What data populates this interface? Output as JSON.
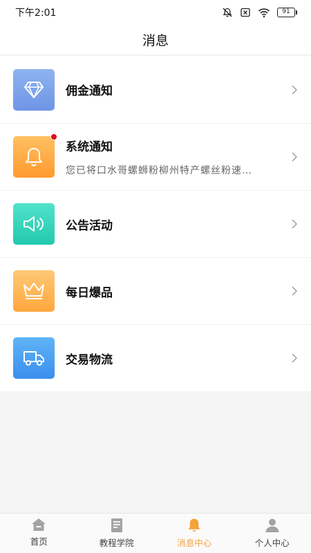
{
  "status_bar": {
    "time": "下午2:01",
    "battery": "91"
  },
  "header": {
    "title": "消息"
  },
  "messages": [
    {
      "title": "佣金通知",
      "subtitle": "",
      "icon": "diamond-icon",
      "color_top": "#8fb3f0",
      "color_bottom": "#6e95e6",
      "unread": false
    },
    {
      "title": "系统通知",
      "subtitle": "您已将口水哥螺蛳粉柳州特产螺丝粉速…",
      "icon": "bell-icon",
      "color_top": "#ffc061",
      "color_bottom": "#ff9a2e",
      "unread": true
    },
    {
      "title": "公告活动",
      "subtitle": "",
      "icon": "speaker-icon",
      "color_top": "#4fe3cb",
      "color_bottom": "#23c9ad",
      "unread": false
    },
    {
      "title": "每日爆品",
      "subtitle": "",
      "icon": "crown-icon",
      "color_top": "#ffc877",
      "color_bottom": "#ffa73d",
      "unread": false
    },
    {
      "title": "交易物流",
      "subtitle": "",
      "icon": "truck-icon",
      "color_top": "#60b4f6",
      "color_bottom": "#3a8fee",
      "unread": false
    }
  ],
  "tabs": [
    {
      "label": "首页",
      "icon": "home-icon",
      "active": false
    },
    {
      "label": "教程学院",
      "icon": "tutorial-icon",
      "active": false
    },
    {
      "label": "消息中心",
      "icon": "bell-icon",
      "active": true
    },
    {
      "label": "个人中心",
      "icon": "person-icon",
      "active": false
    }
  ],
  "colors": {
    "accent": "#f5a23b",
    "badge": "#d9101a",
    "tab_inactive": "#999999"
  }
}
